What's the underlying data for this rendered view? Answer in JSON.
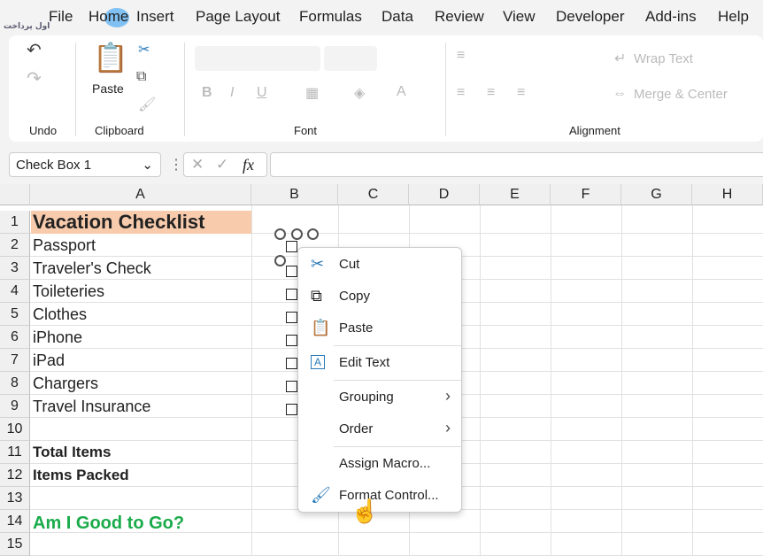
{
  "watermark_logo": "اول پرداخت",
  "tabs": [
    "File",
    "Home",
    "Insert",
    "Page Layout",
    "Formulas",
    "Data",
    "Review",
    "View",
    "Developer",
    "Add-ins",
    "Help"
  ],
  "ribbon": {
    "undo_group": "Undo",
    "clipboard_group": "Clipboard",
    "paste_label": "Paste",
    "font_group": "Font",
    "alignment_group": "Alignment",
    "wrap_text": "Wrap Text",
    "merge_center": "Merge & Center"
  },
  "formula_bar": {
    "name_box": "Check Box 1",
    "fx": "fx",
    "value": ""
  },
  "columns": [
    "A",
    "B",
    "C",
    "D",
    "E",
    "F",
    "G",
    "H"
  ],
  "rows": [
    "1",
    "2",
    "3",
    "4",
    "5",
    "6",
    "7",
    "8",
    "9",
    "10",
    "11",
    "12",
    "13",
    "14",
    "15"
  ],
  "cells": {
    "a1": "Vacation Checklist",
    "a2": "Passport",
    "a3": "Traveler's Check",
    "a4": "Toileteries",
    "a5": "Clothes",
    "a6": "iPhone",
    "a7": "iPad",
    "a8": "Chargers",
    "a9": "Travel Insurance",
    "a11": "Total Items",
    "a12": "Items Packed",
    "a14": "Am I Good to Go?"
  },
  "colors": {
    "title_fill": "#f8cbad",
    "good_to_go": "#1aab4a"
  },
  "context_menu": {
    "cut": "Cut",
    "copy": "Copy",
    "paste": "Paste",
    "edit_text": "Edit Text",
    "grouping": "Grouping",
    "order": "Order",
    "assign_macro": "Assign Macro...",
    "format_control": "Format Control..."
  }
}
